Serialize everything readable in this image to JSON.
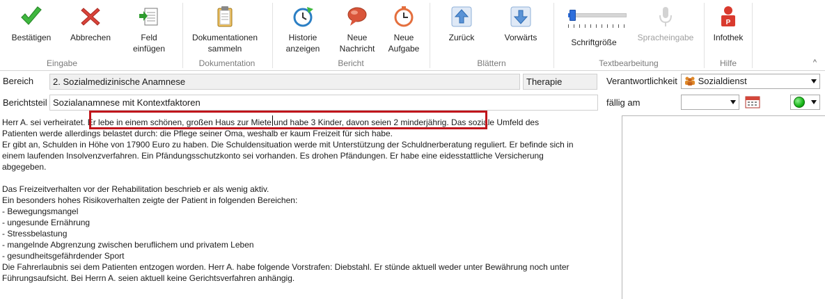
{
  "ribbon": {
    "groups": {
      "eingabe": "Eingabe",
      "dokumentation": "Dokumentation",
      "bericht": "Bericht",
      "blaettern": "Blättern",
      "textbearbeitung": "Textbearbeitung",
      "hilfe": "Hilfe"
    },
    "buttons": {
      "bestaetigen": "Bestätigen",
      "abbrechen": "Abbrechen",
      "feld_einfuegen": "Feld\neinfügen",
      "dok_sammeln": "Dokumentationen\nsammeln",
      "historie": "Historie\nanzeigen",
      "neue_nachricht": "Neue\nNachricht",
      "neue_aufgabe": "Neue\nAufgabe",
      "zurueck": "Zurück",
      "vorwaerts": "Vorwärts",
      "schriftgroesse": "Schriftgröße",
      "spracheingabe": "Spracheingabe",
      "infothek": "Infothek"
    },
    "collapse_glyph": "^",
    "font_size_level": 0.05
  },
  "form": {
    "bereich_label": "Bereich",
    "bereich_value": "2. Sozialmedizinische Anamnese",
    "therapie_value": "Therapie",
    "verantwortlichkeit_label": "Verantwortlichkeit",
    "verantwortlichkeit_value": "Sozialdienst",
    "berichtsteil_label": "Berichtsteil",
    "berichtsteil_value": "Sozialanamnese mit Kontextfaktoren",
    "faellig_label": "fällig am",
    "faellig_value": "",
    "status_color": "#17b517"
  },
  "report_text": {
    "lines": [
      "Herr A. sei verheiratet. Er lebe in einem schönen, großen Haus zur Miete und habe 3 Kinder, davon seien 2 minderjährig. Das soziale Umfeld des",
      "Patienten werde allerdings belastet durch: die Pflege seiner Oma, weshalb er kaum Freizeit für sich habe.",
      "Er gibt an, Schulden in Höhe von 17900 Euro zu haben. Die Schuldensituation werde mit Unterstützung der Schuldnerberatung reguliert. Er befinde sich in",
      "einem laufenden Insolvenzverfahren. Ein Pfändungsschutzkonto sei vorhanden. Es drohen Pfändungen. Er habe eine eidesstattliche Versicherung",
      "abgegeben.",
      "",
      "Das Freizeitverhalten vor der Rehabilitation beschrieb er als wenig aktiv.",
      "Ein besonders hohes Risikoverhalten zeigte der Patient in folgenden Bereichen:",
      "- Bewegungsmangel",
      "- ungesunde Ernährung",
      "- Stressbelastung",
      "- mangelnde Abgrenzung zwischen beruflichem und privatem Leben",
      "- gesundheitsgefährdender Sport",
      "Die Fahrerlaubnis sei dem Patienten entzogen worden. Herr A. habe folgende Vorstrafen: Diebstahl. Er stünde aktuell weder unter Bewährung noch unter",
      "Führungsaufsicht. Bei Herrn A. seien aktuell keine Gerichtsverfahren anhängig."
    ]
  },
  "colors": {
    "highlight_border": "#c0151b",
    "slider_accent": "#2f6fdc"
  }
}
